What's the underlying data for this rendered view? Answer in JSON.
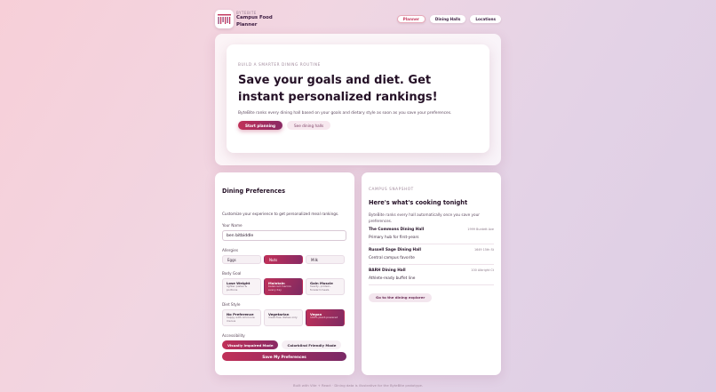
{
  "header": {
    "eyebrow": "BYTEBITE",
    "title_line1": "Campus Food",
    "title_line2": "Planner",
    "nav": [
      {
        "label": "Planner",
        "active": true
      },
      {
        "label": "Dining Halls",
        "active": false
      },
      {
        "label": "Locations",
        "active": false
      }
    ]
  },
  "hero": {
    "eyebrow": "BUILD A SMARTER DINING ROUTINE",
    "title": "Save your goals and diet. Get instant personalized rankings!",
    "subtitle": "ByteBite ranks every dining hall based on your goals and dietary style as soon as you save your preferences.",
    "primary_label": "Start planning",
    "secondary_label": "See dining halls"
  },
  "preferences": {
    "title": "Dining Preferences",
    "subtitle": "Customize your experience to get personalized meal rankings.",
    "name_label": "Your Name",
    "name_value": "ben bitbiddle",
    "allergies_label": "Allergies",
    "allergies": [
      {
        "label": "Eggs",
        "selected": false
      },
      {
        "label": "Nuts",
        "selected": true
      },
      {
        "label": "Milk",
        "selected": false
      }
    ],
    "body_goal_label": "Body Goal",
    "body_goals": [
      {
        "title": "Lose Weight",
        "desc": "lighter plates & portions",
        "selected": false
      },
      {
        "title": "Maintain",
        "desc": "balanced macros every day",
        "selected": true
      },
      {
        "title": "Gain Muscle",
        "desc": "hearty, protein-forward meals",
        "selected": false
      }
    ],
    "diet_style_label": "Diet Style",
    "diet_styles": [
      {
        "title": "No Preference",
        "desc": "happy with omnivore menus",
        "selected": false
      },
      {
        "title": "Vegetarian",
        "desc": "meat-free dishes only",
        "selected": false
      },
      {
        "title": "Vegan",
        "desc": "100% plant-powered",
        "selected": true
      }
    ],
    "accessibility_label": "Accessibility",
    "accessibility": [
      {
        "label": "Visually Impaired Mode",
        "selected": true
      },
      {
        "label": "Colorblind Friendly Mode",
        "selected": false
      }
    ],
    "save_label": "Save My Preferences"
  },
  "snapshot": {
    "eyebrow": "CAMPUS SNAPSHOT",
    "title": "Here's what's cooking tonight",
    "subtitle": "ByteBite ranks every hall automatically once you save your preferences.",
    "halls": [
      {
        "name": "The Commons Dining Hall",
        "address": "1999 Burdett Ave",
        "desc": "Primary hub for first-years"
      },
      {
        "name": "Russell Sage Dining Hall",
        "address": "1649 15th St",
        "desc": "Central campus favorite"
      },
      {
        "name": "BARH Dining Hall",
        "address": "100 Albright Ct",
        "desc": "Athlete-ready buffet line"
      }
    ],
    "explore_label": "Go to the dining explorer"
  },
  "footer": "Built with Vite + React · Dining data is illustrative for the ByteBite prototype.",
  "colors": {
    "accent": "#c03058",
    "accent_dark": "#8a2a64"
  }
}
